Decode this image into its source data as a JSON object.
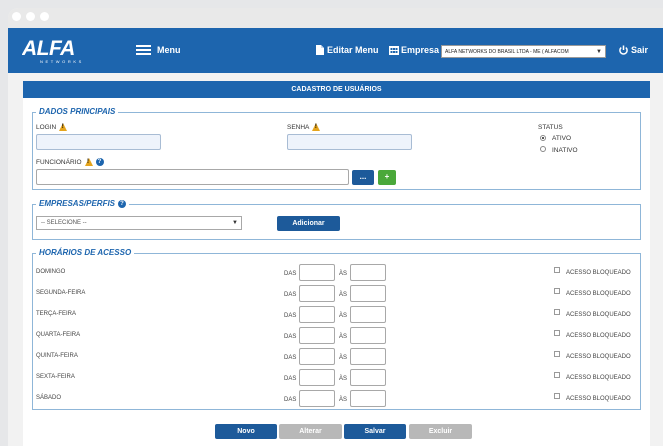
{
  "header": {
    "logo_text": "ALFA",
    "logo_sub": "NETWORKS",
    "menu_label": "Menu",
    "edit_menu_label": "Editar Menu",
    "company_label": "Empresa",
    "company_value": "ALFA NETWORKS DO BRASIL LTDA - ME ( ALFACOM",
    "exit_label": "Sair"
  },
  "form": {
    "title": "CADASTRO DE USUÁRIOS",
    "main_section": {
      "legend": "DADOS PRINCIPAIS",
      "login_label": "LOGIN",
      "senha_label": "SENHA",
      "funcionario_label": "FUNCIONÁRIO",
      "search_btn": "...",
      "add_btn": "+",
      "status_label": "STATUS",
      "status_options": [
        "ATIVO",
        "INATIVO"
      ],
      "status_selected": "ATIVO"
    },
    "companies_section": {
      "legend": "EMPRESAS/PERFIS",
      "select_value": "-- SELECIONE --",
      "add_btn": "Adicionar"
    },
    "schedule_section": {
      "legend": "HORÁRIOS DE ACESSO",
      "from_label": "DAS",
      "to_label": "ÀS",
      "blocked_label": "ACESSO BLOQUEADO",
      "days": [
        "DOMINGO",
        "SEGUNDA-FEIRA",
        "TERÇA-FEIRA",
        "QUARTA-FEIRA",
        "QUINTA-FEIRA",
        "SEXTA-FEIRA",
        "SÁBADO"
      ]
    },
    "actions": {
      "novo": "Novo",
      "alterar": "Alterar",
      "salvar": "Salvar",
      "excluir": "Excluir"
    }
  },
  "colors": {
    "primary": "#1d65ae",
    "navy_button": "#1d5a9a",
    "green_button": "#4aa83a",
    "disabled_button": "#b8b8b8",
    "warning": "#e5a51d"
  }
}
